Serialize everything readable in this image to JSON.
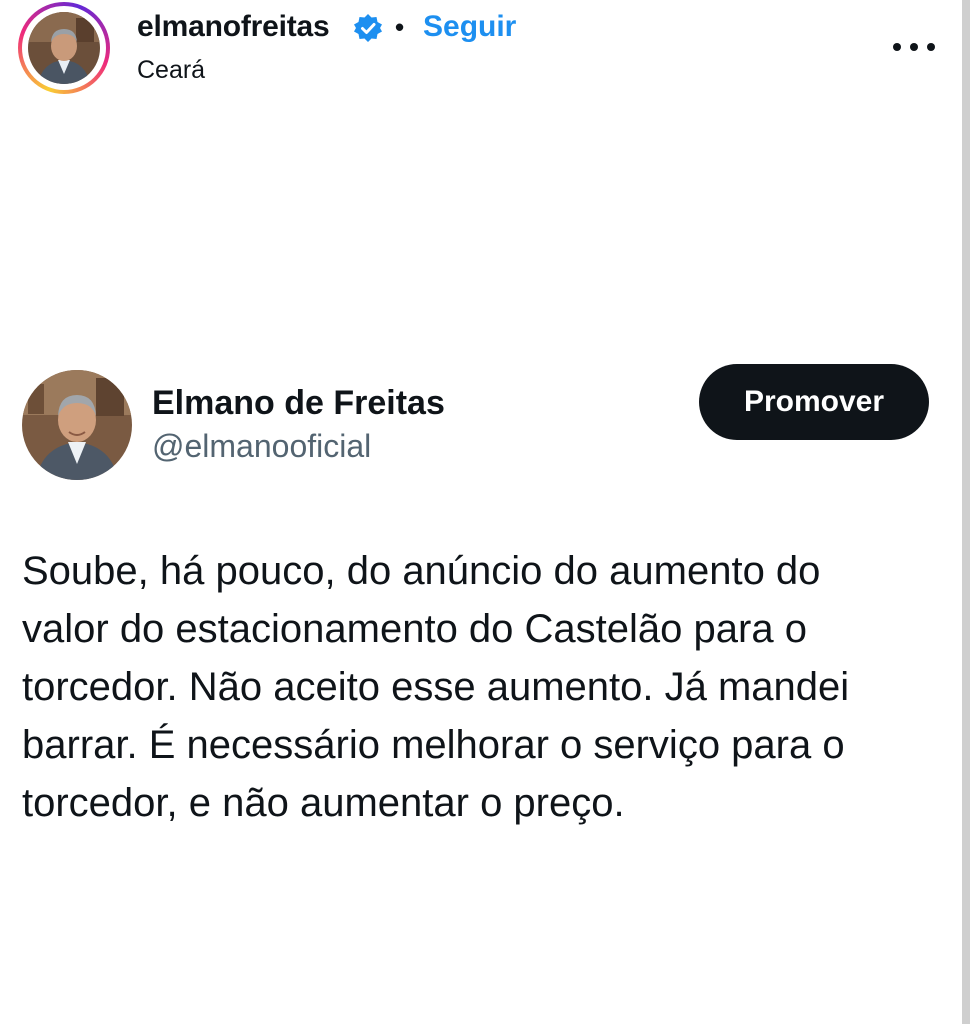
{
  "header": {
    "username": "elmanofreitas",
    "separator": "•",
    "follow_label": "Seguir",
    "location": "Ceará",
    "verified_icon": "verified-badge-icon",
    "more_icon": "more-options-icon",
    "follow_color": "#1d8ff0"
  },
  "tweet": {
    "display_name": "Elmano de Freitas",
    "handle": "@elmanooficial",
    "promote_label": "Promover",
    "text": "Soube, há pouco, do anúncio do aumento do\nvalor do estacionamento do Castelão para o\ntorcedor. Não aceito esse aumento. Já mandei\nbarrar. É necessário melhorar o serviço para o\ntorcedor, e não aumentar o preço."
  }
}
